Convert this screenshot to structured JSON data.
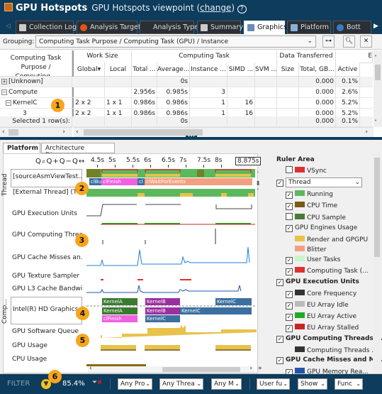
{
  "header": {
    "app_title": "GPU Hotspots",
    "viewpoint": "GPU Hotspots viewpoint (",
    "change_link": "change",
    "viewpoint_end": ")",
    "help": "?"
  },
  "tabs": [
    {
      "label": "Collection Log"
    },
    {
      "label": "Analysis Target"
    },
    {
      "label": "Analysis Type"
    },
    {
      "label": "Summary"
    },
    {
      "label": "Graphics",
      "active": true
    },
    {
      "label": "Platform"
    },
    {
      "label": "Bott"
    }
  ],
  "grouping": {
    "label": "Grouping:",
    "value": "Computing Task Purpose / Computing Task (GPU) / Instance"
  },
  "table": {
    "first_col_header": "Computing Task Purpose / Computing...",
    "groups": [
      "Work Size",
      "Computing Task",
      "Data Transferred",
      "E"
    ],
    "columns": [
      "Global",
      "Local",
      "Total ...",
      "Average...",
      "Instance ...",
      "SIMD ...",
      "SVM ...",
      "Size",
      "Total, GB...",
      "Active"
    ],
    "rows": [
      {
        "name": "[Unknown]",
        "expander": "+",
        "cells": [
          "",
          "",
          "",
          "0s",
          "",
          "",
          "",
          "",
          "0.000",
          "0.1%"
        ]
      },
      {
        "name": "Compute",
        "expander": "−",
        "cells": [
          "",
          "",
          "2.956s",
          "0.985s",
          "3",
          "",
          "",
          "",
          "0.000",
          "2.6%"
        ]
      },
      {
        "name": "KernelC",
        "expander": "−",
        "cells": [
          "2 x 2",
          "1 x 1",
          "0.986s",
          "0.986s",
          "1",
          "16",
          "",
          "",
          "0.000",
          "5.2%"
        ]
      },
      {
        "name": "3",
        "expander": "",
        "cells": [
          "2 x 2",
          "1 x 1",
          "0.986s",
          "0.986s",
          "1",
          "16",
          "",
          "",
          "0.000",
          "5.2%"
        ]
      }
    ],
    "selected": {
      "label": "Selected 1 row(s):",
      "cells": [
        "",
        "",
        "",
        "0s",
        "",
        "",
        "",
        "",
        "0.000",
        "0.1%"
      ]
    }
  },
  "bottom_tabs": [
    {
      "label": "Platform",
      "active": true
    },
    {
      "label": "Architecture Diagram"
    }
  ],
  "timeline": {
    "ticks": [
      "4.5s",
      "5s",
      "5.5s",
      "6s",
      "6.5s",
      "7s",
      "7.5s",
      "8s"
    ],
    "end_time": "8.875s",
    "thread_group": "Thread",
    "comp_group": "Comp...",
    "rows": [
      "[sourceAsmViewTest....",
      "[External Thread] (TID...",
      "GPU Execution Units",
      "GPU Computing Threa",
      "GPU Cache Misses an...",
      "GPU Texture Sampler",
      "GPU L3 Cache Bandwi...",
      "Intel(R) HD Graphics 4",
      "GPU Software Queue",
      "GPU Usage",
      "CPU Usage"
    ],
    "tasks": [
      "clBu",
      "clFinish",
      "cl",
      "clWaitForEvents"
    ],
    "kernels": [
      "KernelA",
      "KernelB",
      "KernelC",
      "KernelA",
      "KernelB",
      "KernelC",
      "clFinish",
      "KernelC"
    ]
  },
  "ruler": {
    "title": "Ruler Area",
    "thread_select": "Thread",
    "items": [
      {
        "label": "VSync",
        "checked": false,
        "indent": 1,
        "color": "#e03030"
      },
      {
        "label": "Running",
        "checked": true,
        "indent": 1,
        "color": "#5cb85c"
      },
      {
        "label": "CPU Time",
        "checked": true,
        "indent": 1,
        "color": "#7a5a10"
      },
      {
        "label": "CPU Sample",
        "checked": false,
        "indent": 1,
        "color": "#4a7a3a"
      },
      {
        "label": "GPU Engines Usage",
        "checked": true,
        "indent": 1
      },
      {
        "label": "Render and GPGPU",
        "indent": 2,
        "color": "#e8c24a"
      },
      {
        "label": "Blitter",
        "indent": 2,
        "color": "#f4a080"
      },
      {
        "label": "User Tasks",
        "checked": true,
        "indent": 1,
        "color": "#c8f5c8"
      },
      {
        "label": "Computing Task (...",
        "checked": true,
        "indent": 1,
        "color": "#e03030"
      },
      {
        "label": "GPU Execution Units",
        "checked": true,
        "indent": 0,
        "bold": true
      },
      {
        "label": "Core Frequency",
        "checked": true,
        "indent": 1,
        "color": "#333"
      },
      {
        "label": "EU Array Idle",
        "checked": true,
        "indent": 1,
        "color": "#bbb"
      },
      {
        "label": "EU Array Active",
        "checked": true,
        "indent": 1,
        "color": "#22aa22"
      },
      {
        "label": "EU Array Stalled",
        "checked": true,
        "indent": 1,
        "color": "#cc2222"
      },
      {
        "label": "GPU Computing Threads ...",
        "checked": true,
        "indent": 0,
        "bold": true
      },
      {
        "label": "Computing Threads ...",
        "indent": 2,
        "color": "#333"
      },
      {
        "label": "GPU Cache Misses and M...",
        "checked": true,
        "indent": 0,
        "bold": true
      },
      {
        "label": "GPU Memory Rea...",
        "checked": true,
        "indent": 1,
        "color": "#2255aa"
      }
    ]
  },
  "filter": {
    "label": "FILTER",
    "percent": "85.4%",
    "dropdowns": [
      "Any Pro",
      "Any Threa",
      "Any M",
      "User fu",
      "Show",
      "Func"
    ]
  },
  "callouts": [
    "1",
    "2",
    "3",
    "4",
    "5",
    "6"
  ]
}
